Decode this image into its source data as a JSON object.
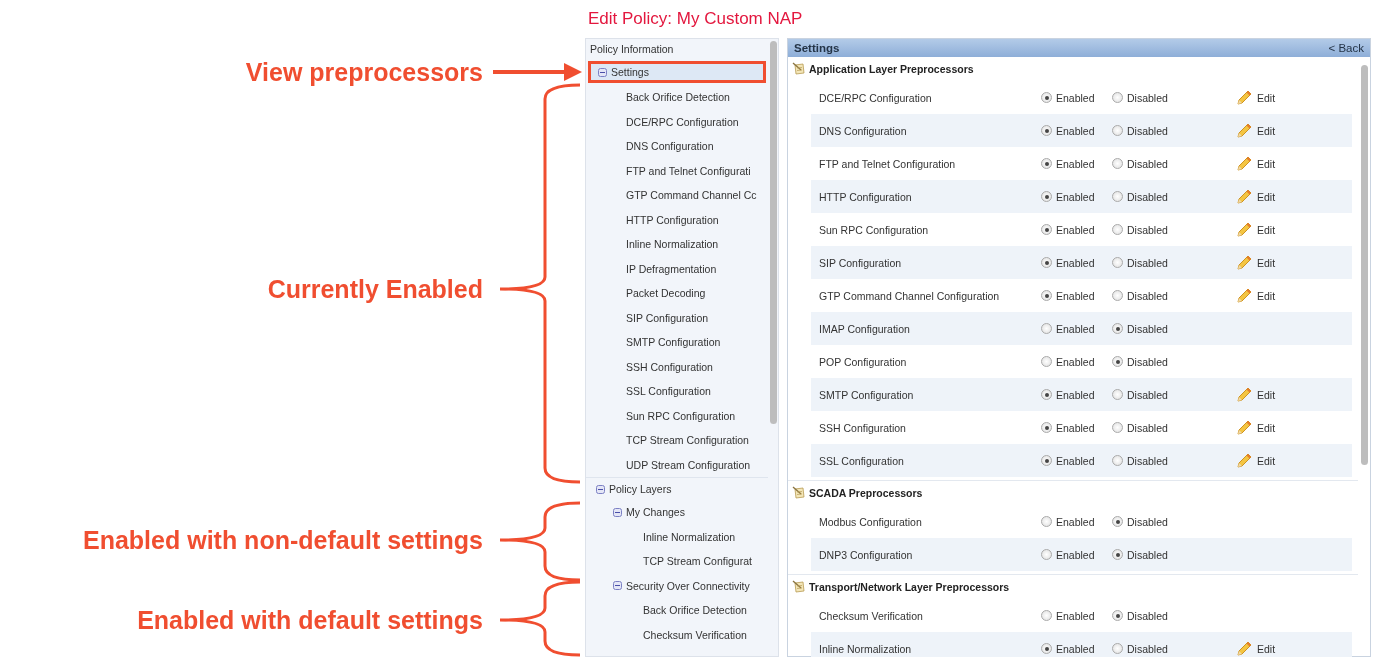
{
  "title": "Edit Policy: My Custom NAP",
  "annotations": [
    {
      "kind": "arrow",
      "text": "View preprocessors"
    },
    {
      "kind": "brace",
      "text": "Currently Enabled"
    },
    {
      "kind": "brace",
      "text": "Enabled with non-default settings"
    },
    {
      "kind": "brace",
      "text": "Enabled with default settings"
    }
  ],
  "nav": {
    "heading": "Policy Information",
    "items": [
      {
        "label": "Settings",
        "expanded": true,
        "selected": true,
        "children": [
          {
            "label": "Back Orifice Detection",
            "selected": false
          },
          {
            "label": "DCE/RPC Configuration",
            "selected": false
          },
          {
            "label": "DNS Configuration",
            "selected": false
          },
          {
            "label": "FTP and Telnet Configurati",
            "selected": false
          },
          {
            "label": "GTP Command Channel Cc",
            "selected": false
          },
          {
            "label": "HTTP Configuration",
            "selected": false
          },
          {
            "label": "Inline Normalization",
            "selected": false
          },
          {
            "label": "IP Defragmentation",
            "selected": false
          },
          {
            "label": "Packet Decoding",
            "selected": false
          },
          {
            "label": "SIP Configuration",
            "selected": false
          },
          {
            "label": "SMTP Configuration",
            "selected": false
          },
          {
            "label": "SSH Configuration",
            "selected": false
          },
          {
            "label": "SSL Configuration",
            "selected": false
          },
          {
            "label": "Sun RPC Configuration",
            "selected": false
          },
          {
            "label": "TCP Stream Configuration",
            "selected": false
          },
          {
            "label": "UDP Stream Configuration",
            "selected": false
          }
        ]
      },
      {
        "label": "Policy Layers",
        "expanded": true,
        "selected": false,
        "children": [
          {
            "label": "My Changes",
            "expanded": true,
            "selected": false,
            "children": [
              {
                "label": "Inline Normalization",
                "selected": false
              },
              {
                "label": "TCP Stream Configurat",
                "selected": false
              }
            ]
          },
          {
            "label": "Security Over Connectivity",
            "expanded": true,
            "selected": false,
            "children": [
              {
                "label": "Back Orifice Detection",
                "selected": false
              },
              {
                "label": "Checksum Verification",
                "selected": false
              }
            ]
          }
        ]
      }
    ]
  },
  "settings": {
    "title": "Settings",
    "back": "< Back",
    "sections": [
      {
        "title": "Application Layer Preprocessors",
        "rows": [
          {
            "name": "DCE/RPC Configuration",
            "options": [
              {
                "label": "Enabled",
                "selected": true
              },
              {
                "label": "Disabled",
                "selected": false
              }
            ],
            "edit": "Edit"
          },
          {
            "name": "DNS Configuration",
            "options": [
              {
                "label": "Enabled",
                "selected": true
              },
              {
                "label": "Disabled",
                "selected": false
              }
            ],
            "edit": "Edit"
          },
          {
            "name": "FTP and Telnet Configuration",
            "options": [
              {
                "label": "Enabled",
                "selected": true
              },
              {
                "label": "Disabled",
                "selected": false
              }
            ],
            "edit": "Edit"
          },
          {
            "name": "HTTP Configuration",
            "options": [
              {
                "label": "Enabled",
                "selected": true
              },
              {
                "label": "Disabled",
                "selected": false
              }
            ],
            "edit": "Edit"
          },
          {
            "name": "Sun RPC Configuration",
            "options": [
              {
                "label": "Enabled",
                "selected": true
              },
              {
                "label": "Disabled",
                "selected": false
              }
            ],
            "edit": "Edit"
          },
          {
            "name": "SIP Configuration",
            "options": [
              {
                "label": "Enabled",
                "selected": true
              },
              {
                "label": "Disabled",
                "selected": false
              }
            ],
            "edit": "Edit"
          },
          {
            "name": "GTP Command Channel Configuration",
            "options": [
              {
                "label": "Enabled",
                "selected": true
              },
              {
                "label": "Disabled",
                "selected": false
              }
            ],
            "edit": "Edit"
          },
          {
            "name": "IMAP Configuration",
            "options": [
              {
                "label": "Enabled",
                "selected": false
              },
              {
                "label": "Disabled",
                "selected": true
              }
            ]
          },
          {
            "name": "POP Configuration",
            "options": [
              {
                "label": "Enabled",
                "selected": false
              },
              {
                "label": "Disabled",
                "selected": true
              }
            ]
          },
          {
            "name": "SMTP Configuration",
            "options": [
              {
                "label": "Enabled",
                "selected": true
              },
              {
                "label": "Disabled",
                "selected": false
              }
            ],
            "edit": "Edit"
          },
          {
            "name": "SSH Configuration",
            "options": [
              {
                "label": "Enabled",
                "selected": true
              },
              {
                "label": "Disabled",
                "selected": false
              }
            ],
            "edit": "Edit"
          },
          {
            "name": "SSL Configuration",
            "options": [
              {
                "label": "Enabled",
                "selected": true
              },
              {
                "label": "Disabled",
                "selected": false
              }
            ],
            "edit": "Edit"
          }
        ]
      },
      {
        "title": "SCADA Preprocessors",
        "rows": [
          {
            "name": "Modbus Configuration",
            "options": [
              {
                "label": "Enabled",
                "selected": false
              },
              {
                "label": "Disabled",
                "selected": true
              }
            ]
          },
          {
            "name": "DNP3 Configuration",
            "options": [
              {
                "label": "Enabled",
                "selected": false
              },
              {
                "label": "Disabled",
                "selected": true
              }
            ]
          }
        ]
      },
      {
        "title": "Transport/Network Layer Preprocessors",
        "rows": [
          {
            "name": "Checksum Verification",
            "options": [
              {
                "label": "Enabled",
                "selected": false
              },
              {
                "label": "Disabled",
                "selected": true
              }
            ]
          },
          {
            "name": "Inline Normalization",
            "options": [
              {
                "label": "Enabled",
                "selected": true
              },
              {
                "label": "Disabled",
                "selected": false
              }
            ],
            "edit": "Edit"
          }
        ]
      }
    ]
  }
}
